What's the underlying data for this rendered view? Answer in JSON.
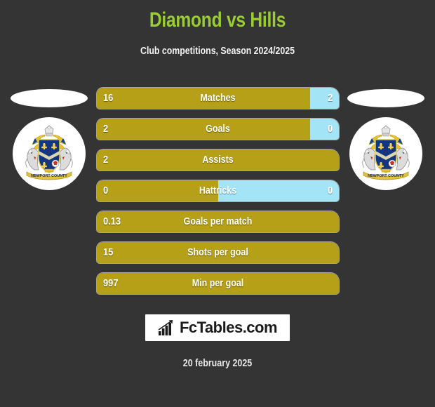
{
  "header": {
    "title": "Diamond vs Hills",
    "subtitle": "Club competitions, Season 2024/2025",
    "title_color": "#9ACD32"
  },
  "theme": {
    "background": "#343434",
    "home_color": "#B5A017",
    "away_color": "#A3E4F7",
    "text_color": "#ffffff"
  },
  "home_team": {
    "crest_icon": "newport-county-crest-icon",
    "name_plate": ""
  },
  "away_team": {
    "crest_icon": "newport-county-crest-icon",
    "name_plate": ""
  },
  "chart_data": {
    "type": "bar",
    "title": "Diamond vs Hills",
    "subtitle": "Club competitions, Season 2024/2025",
    "orientation": "horizontal-diverging",
    "categories": [
      "Matches",
      "Goals",
      "Assists",
      "Hattricks",
      "Goals per match",
      "Shots per goal",
      "Min per goal"
    ],
    "series": [
      {
        "name": "Diamond",
        "color": "#B5A017",
        "values": [
          "16",
          "2",
          "2",
          "0",
          "0.13",
          "15",
          "997"
        ]
      },
      {
        "name": "Hills",
        "color": "#A3E4F7",
        "values": [
          "2",
          "0",
          "",
          "0",
          "",
          "",
          ""
        ]
      }
    ],
    "home_share_percent": [
      88,
      88,
      100,
      50,
      100,
      100,
      100
    ],
    "grid": false,
    "legend": false
  },
  "rows": [
    {
      "label": "Matches",
      "home": "16",
      "away": "2",
      "home_pct": 88,
      "has_away": true
    },
    {
      "label": "Goals",
      "home": "2",
      "away": "0",
      "home_pct": 88,
      "has_away": true
    },
    {
      "label": "Assists",
      "home": "2",
      "away": "",
      "home_pct": 100,
      "has_away": false
    },
    {
      "label": "Hattricks",
      "home": "0",
      "away": "0",
      "home_pct": 50,
      "has_away": true
    },
    {
      "label": "Goals per match",
      "home": "0.13",
      "away": "",
      "home_pct": 100,
      "has_away": false
    },
    {
      "label": "Shots per goal",
      "home": "15",
      "away": "",
      "home_pct": 100,
      "has_away": false
    },
    {
      "label": "Min per goal",
      "home": "997",
      "away": "",
      "home_pct": 100,
      "has_away": false
    }
  ],
  "footer": {
    "brand": "FcTables.com",
    "brand_icon": "bar-chart-growth-icon",
    "date": "20 february 2025"
  }
}
